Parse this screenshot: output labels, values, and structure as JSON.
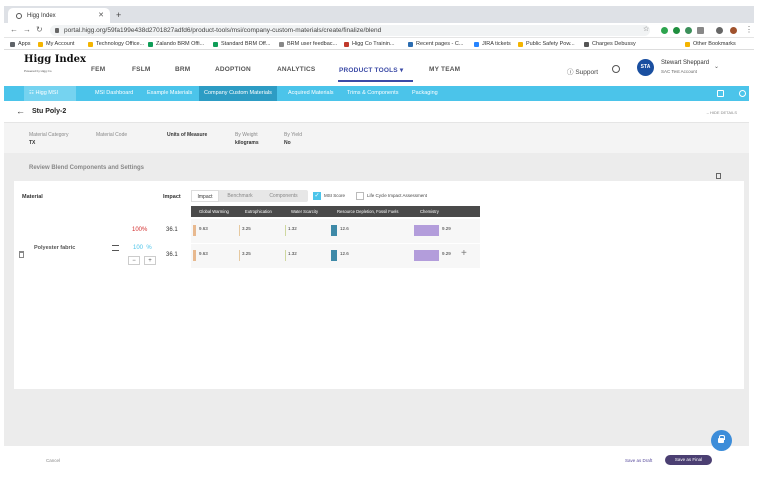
{
  "browser": {
    "tab_title": "Higg Index",
    "url": "portal.higg.org/59fa199e438d2701827adfd6/product-tools/msi/company-custom-materials/create/finalize/blend",
    "bookmarks": [
      "Apps",
      "My Account",
      "Technology Office...",
      "Zalando BRM Offi...",
      "Standard BRM Off...",
      "BRM user feedbac...",
      "Higg Co Trainin...",
      "Recent pages - C...",
      "JIRA tickets",
      "Public Safety Pow...",
      "Charges Debussy",
      "Other Bookmarks"
    ]
  },
  "header": {
    "logo": "Higg Index",
    "logo_sub": "Powered by Higg Co",
    "nav": [
      "FEM",
      "FSLM",
      "BRM",
      "ADOPTION",
      "ANALYTICS",
      "PRODUCT TOOLS",
      "MY TEAM"
    ],
    "support": "Support",
    "avatar_initials": "STA",
    "user_name": "Stewart Sheppard",
    "user_account": "SAC Test Account"
  },
  "subnav": [
    "Higg MSI",
    "MSI Dashboard",
    "Example Materials",
    "Company Custom Materials",
    "Acquired Materials",
    "Trims & Components",
    "Packaging"
  ],
  "page": {
    "title": "Stu Poly-2",
    "hide_details": "HIDE DETAILS",
    "meta": [
      {
        "label": "Material Category",
        "value": "TX"
      },
      {
        "label": "Material Code",
        "value": ""
      },
      {
        "label": "Units of Measure",
        "value": ""
      },
      {
        "label": "By Weight",
        "value": "kilograms"
      },
      {
        "label": "By Yield",
        "value": "No"
      }
    ],
    "review_title": "Review Blend Components and Settings"
  },
  "table": {
    "material_header": "Material",
    "impact_header": "Impact",
    "tabs": [
      "Impact",
      "Benchmark",
      "Components"
    ],
    "msi_score": "MSI Score",
    "lca": "Life Cycle Impact Assessment",
    "columns": [
      "Global Warming",
      "Eutrophication",
      "Water Scarcity",
      "Resource Depletion, Fossil Fuels",
      "Chemistry"
    ],
    "total_pct": "100%",
    "rows": [
      {
        "impact": "36.1",
        "values": [
          "9.63",
          "3.25",
          "1.32",
          "12.6",
          "9.29"
        ]
      },
      {
        "impact": "36.1",
        "values": [
          "9.63",
          "3.25",
          "1.32",
          "12.6",
          "9.29"
        ]
      }
    ],
    "material_name": "Polyester fabric",
    "material_pct": "100",
    "pct_sign": "%",
    "minus": "−",
    "plus": "+"
  },
  "footer": {
    "cancel": "Cancel",
    "save_draft": "Save as Draft",
    "save_final": "Save as Final"
  },
  "colors": {
    "subnav": "#4bc4ea",
    "bar_gw": "#e8b98f",
    "bar_eu": "#e6c9a0",
    "bar_ws": "#cfd8a0",
    "bar_rd": "#3e8aa8",
    "bar_ch": "#b39ddb"
  }
}
